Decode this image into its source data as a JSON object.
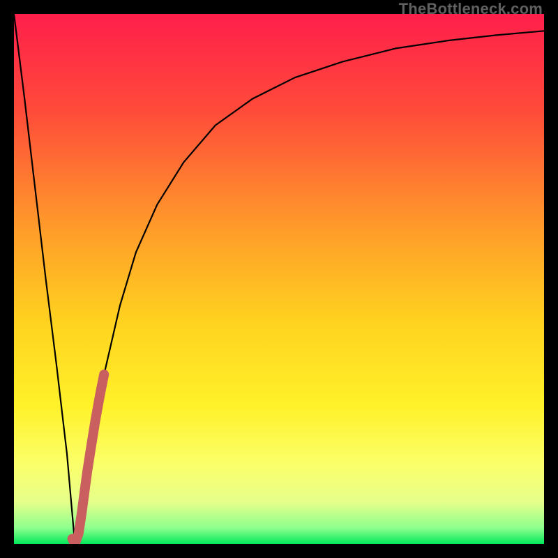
{
  "watermark": "TheBottleneck.com",
  "chart_data": {
    "type": "line",
    "xlabel": "",
    "ylabel": "",
    "xlim": [
      0,
      100
    ],
    "ylim": [
      0,
      100
    ],
    "grid": false,
    "title": "",
    "series": [
      {
        "name": "curve",
        "x": [
          0,
          2,
          4,
          6,
          8,
          10,
          11.5,
          13,
          15,
          17,
          20,
          23,
          27,
          32,
          38,
          45,
          53,
          62,
          72,
          82,
          91,
          100
        ],
        "y": [
          100,
          84,
          67,
          50,
          34,
          17,
          0,
          9,
          21,
          32,
          45,
          55,
          64,
          72,
          79,
          84,
          88,
          91,
          93.5,
          95,
          96,
          96.8
        ]
      },
      {
        "name": "highlight",
        "x": [
          11.0,
          11.5,
          12.2,
          12.8,
          13.2,
          13.8,
          14.5,
          15.3,
          16.2,
          17.0
        ],
        "y": [
          1.0,
          0.0,
          2.0,
          6.0,
          9.0,
          13.5,
          18.0,
          23.0,
          28.0,
          32.0
        ]
      }
    ],
    "gradient_stops": [
      {
        "offset": 0,
        "color": "#ff1f4b"
      },
      {
        "offset": 18,
        "color": "#ff4a3a"
      },
      {
        "offset": 40,
        "color": "#ff9a2a"
      },
      {
        "offset": 58,
        "color": "#ffd21f"
      },
      {
        "offset": 74,
        "color": "#fff22a"
      },
      {
        "offset": 85,
        "color": "#fbff6a"
      },
      {
        "offset": 92,
        "color": "#e6ff8a"
      },
      {
        "offset": 97,
        "color": "#8dff8d"
      },
      {
        "offset": 100,
        "color": "#00e85a"
      }
    ],
    "colors": {
      "curve": "#000000",
      "highlight": "#c9605f",
      "background_top": "#ff1f4b",
      "background_bottom": "#00e85a"
    }
  }
}
